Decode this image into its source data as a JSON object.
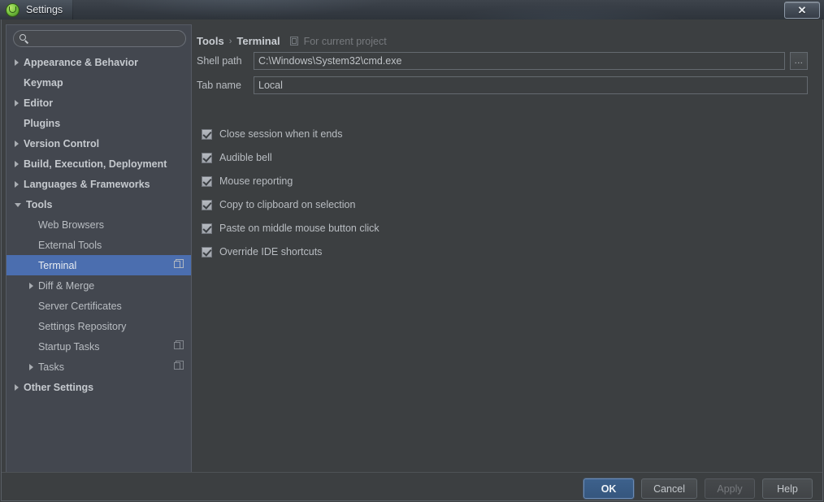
{
  "window": {
    "title": "Settings",
    "app_icon": "intellij-idea-icon",
    "close_label": "✕"
  },
  "colors": {
    "window_bg": "#3c3f41",
    "sidebar_bg": "#43474f",
    "selection": "#4b6eaf",
    "primary_button": "#365880",
    "text": "#b9bdc2",
    "muted_text": "#76797d"
  },
  "sidebar": {
    "search": {
      "value": "",
      "placeholder": ""
    },
    "items": [
      {
        "label": "Appearance & Behavior",
        "arrow": "right",
        "depth": 0,
        "top": true,
        "selected": false,
        "trail_icon": null
      },
      {
        "label": "Keymap",
        "arrow": "none",
        "depth": 0,
        "top": true,
        "selected": false,
        "trail_icon": null
      },
      {
        "label": "Editor",
        "arrow": "right",
        "depth": 0,
        "top": true,
        "selected": false,
        "trail_icon": null
      },
      {
        "label": "Plugins",
        "arrow": "none",
        "depth": 0,
        "top": true,
        "selected": false,
        "trail_icon": null
      },
      {
        "label": "Version Control",
        "arrow": "right",
        "depth": 0,
        "top": true,
        "selected": false,
        "trail_icon": null
      },
      {
        "label": "Build, Execution, Deployment",
        "arrow": "right",
        "depth": 0,
        "top": true,
        "selected": false,
        "trail_icon": null
      },
      {
        "label": "Languages & Frameworks",
        "arrow": "right",
        "depth": 0,
        "top": true,
        "selected": false,
        "trail_icon": null
      },
      {
        "label": "Tools",
        "arrow": "down",
        "depth": 0,
        "top": true,
        "selected": false,
        "trail_icon": null
      },
      {
        "label": "Web Browsers",
        "arrow": "none",
        "depth": 1,
        "top": false,
        "selected": false,
        "trail_icon": null
      },
      {
        "label": "External Tools",
        "arrow": "none",
        "depth": 1,
        "top": false,
        "selected": false,
        "trail_icon": null
      },
      {
        "label": "Terminal",
        "arrow": "none",
        "depth": 1,
        "top": false,
        "selected": true,
        "trail_icon": "copy-icon"
      },
      {
        "label": "Diff & Merge",
        "arrow": "right",
        "depth": 1,
        "top": false,
        "selected": false,
        "trail_icon": null
      },
      {
        "label": "Server Certificates",
        "arrow": "none",
        "depth": 1,
        "top": false,
        "selected": false,
        "trail_icon": null
      },
      {
        "label": "Settings Repository",
        "arrow": "none",
        "depth": 1,
        "top": false,
        "selected": false,
        "trail_icon": null
      },
      {
        "label": "Startup Tasks",
        "arrow": "none",
        "depth": 1,
        "top": false,
        "selected": false,
        "trail_icon": "copy-icon"
      },
      {
        "label": "Tasks",
        "arrow": "right",
        "depth": 1,
        "top": false,
        "selected": false,
        "trail_icon": "copy-icon"
      },
      {
        "label": "Other Settings",
        "arrow": "right",
        "depth": 0,
        "top": true,
        "selected": false,
        "trail_icon": null
      }
    ]
  },
  "main": {
    "breadcrumb": {
      "parent": "Tools",
      "separator": "›",
      "current": "Terminal",
      "scope_icon": "project-scope-icon",
      "scope_note": "For current project"
    },
    "fields": [
      {
        "label": "Shell path",
        "value": "C:\\Windows\\System32\\cmd.exe",
        "placeholder": "",
        "browse_label": "..."
      },
      {
        "label": "Tab name",
        "value": "Local",
        "placeholder": "",
        "browse_label": null
      }
    ],
    "checkboxes": [
      {
        "label": "Close session when it ends",
        "checked": true
      },
      {
        "label": "Audible bell",
        "checked": true
      },
      {
        "label": "Mouse reporting",
        "checked": true
      },
      {
        "label": "Copy to clipboard on selection",
        "checked": true
      },
      {
        "label": "Paste on middle mouse button click",
        "checked": true
      },
      {
        "label": "Override IDE shortcuts",
        "checked": true
      }
    ]
  },
  "footer": {
    "buttons": [
      {
        "label": "OK",
        "style": "primary"
      },
      {
        "label": "Cancel",
        "style": "normal"
      },
      {
        "label": "Apply",
        "style": "disabled"
      },
      {
        "label": "Help",
        "style": "normal"
      }
    ]
  }
}
